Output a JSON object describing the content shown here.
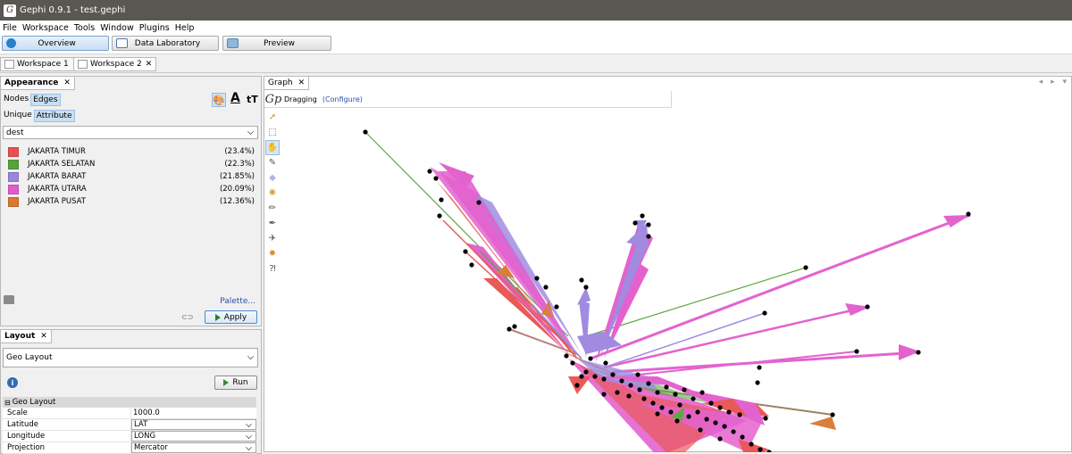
{
  "window": {
    "title": "Gephi 0.9.1 - test.gephi"
  },
  "menu": [
    "File",
    "Workspace",
    "Tools",
    "Window",
    "Plugins",
    "Help"
  ],
  "modes": [
    {
      "label": "Overview",
      "color": "#2a7fc9"
    },
    {
      "label": "Data Laboratory",
      "color": "#4a78a8"
    },
    {
      "label": "Preview",
      "color": "#4e86b8"
    }
  ],
  "workspaces": [
    "Workspace 1",
    "Workspace 2"
  ],
  "appearance": {
    "title": "Appearance",
    "target_tabs": [
      "Nodes",
      "Edges"
    ],
    "mode_tabs": [
      "Unique",
      "Attribute"
    ],
    "attribute": "dest",
    "legend": [
      {
        "label": "JAKARTA TIMUR",
        "pct": "(23.4%)",
        "color": "#e8514f"
      },
      {
        "label": "JAKARTA SELATAN",
        "pct": "(22.3%)",
        "color": "#56a33c"
      },
      {
        "label": "JAKARTA BARAT",
        "pct": "(21.85%)",
        "color": "#9b85df"
      },
      {
        "label": "JAKARTA UTARA",
        "pct": "(20.09%)",
        "color": "#e25bcc"
      },
      {
        "label": "JAKARTA PUSAT",
        "pct": "(12.36%)",
        "color": "#d9782f"
      }
    ],
    "palette_link": "Palette...",
    "apply_label": "Apply"
  },
  "layout": {
    "title": "Layout",
    "algorithm": "Geo Layout",
    "run_label": "Run",
    "section": "Geo Layout",
    "properties": [
      {
        "key": "Scale",
        "value": "1000.0"
      },
      {
        "key": "Latitude",
        "value": "LAT"
      },
      {
        "key": "Longitude",
        "value": "LONG"
      },
      {
        "key": "Projection",
        "value": "Mercator"
      }
    ]
  },
  "graph": {
    "tab": "Graph",
    "tool_status": "Dragging",
    "configure_link": "(Configure)"
  }
}
